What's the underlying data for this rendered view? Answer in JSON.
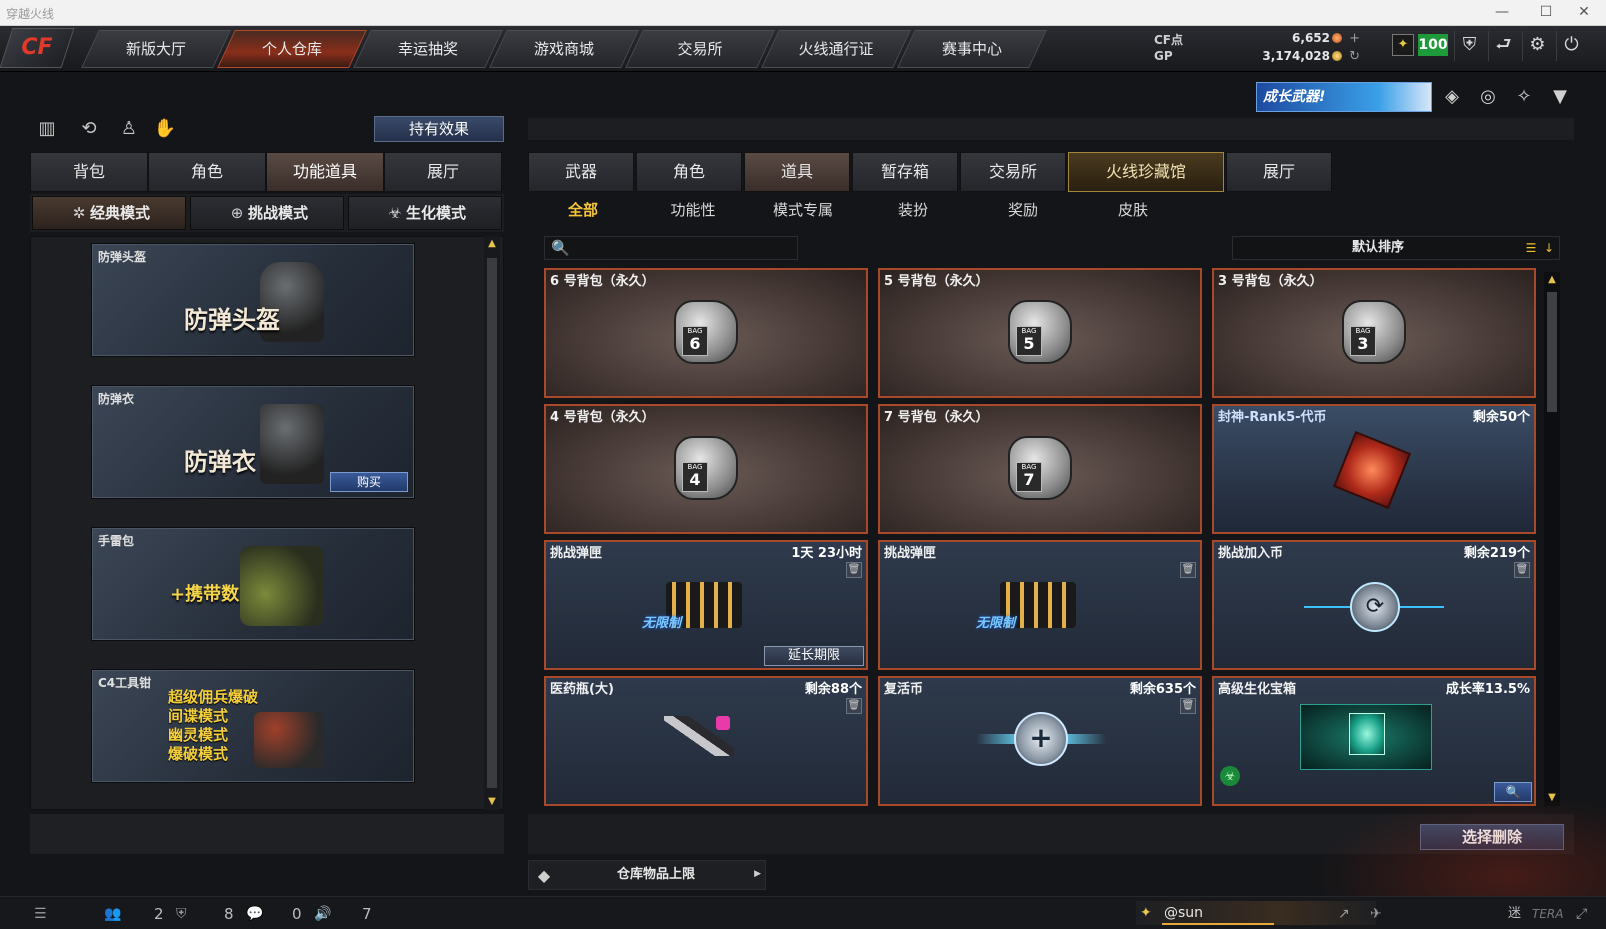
{
  "window": {
    "title": "穿越火线"
  },
  "nav": {
    "logo": "CF",
    "tabs": [
      "新版大厅",
      "个人仓库",
      "幸运抽奖",
      "游戏商城",
      "交易所",
      "火线通行证",
      "赛事中心"
    ],
    "active_tab": "个人仓库"
  },
  "currency": {
    "cf_label": "CF点",
    "cf_value": "6,652",
    "gp_label": "GP",
    "gp_value": "3,174,028"
  },
  "player": {
    "level": "100",
    "name": "@sun"
  },
  "banner": {
    "label": "成长武器!"
  },
  "left": {
    "hold_effect_label": "持有效果",
    "tabs": [
      "背包",
      "角色",
      "功能道具",
      "展厅"
    ],
    "active_tab": "功能道具",
    "modes": [
      "经典模式",
      "挑战模式",
      "生化模式"
    ],
    "active_mode": "经典模式",
    "items": [
      {
        "caption": "防弹头盔",
        "big_text": "防弹头盔"
      },
      {
        "caption": "防弹衣",
        "big_text": "防弹衣",
        "button": "购买"
      },
      {
        "caption": "手雷包",
        "big_text": "+携带数"
      },
      {
        "caption": "C4工具钳",
        "lines": [
          "超级佣兵爆破",
          "间谍模式",
          "幽灵模式",
          "爆破模式"
        ]
      }
    ]
  },
  "right": {
    "tabs": [
      "武器",
      "角色",
      "道具",
      "暂存箱",
      "交易所",
      "火线珍藏馆",
      "展厅"
    ],
    "active_tab": "道具",
    "special_tab": "火线珍藏馆",
    "subtabs": [
      "全部",
      "功能性",
      "模式专属",
      "装扮",
      "奖励",
      "皮肤"
    ],
    "active_subtab": "全部",
    "search": {
      "placeholder": "",
      "value": ""
    },
    "sort_label": "默认排序",
    "items": [
      {
        "name": "6 号背包（永久）",
        "note": "",
        "bag_no": "6",
        "bag_tag": "BAG"
      },
      {
        "name": "5 号背包（永久）",
        "note": "",
        "bag_no": "5",
        "bag_tag": "BAG"
      },
      {
        "name": "3 号背包（永久）",
        "note": "",
        "bag_no": "3",
        "bag_tag": "BAG"
      },
      {
        "name": "4 号背包（永久）",
        "note": "",
        "bag_no": "4",
        "bag_tag": "BAG"
      },
      {
        "name": "7 号背包（永久）",
        "note": "",
        "bag_no": "7",
        "bag_tag": "BAG"
      },
      {
        "name": "封神-Rank5-代币",
        "note": "剩余50个"
      },
      {
        "name": "挑战弹匣",
        "note": "1天 23小时",
        "tag": "无限制",
        "button": "延长期限"
      },
      {
        "name": "挑战弹匣",
        "note": "",
        "tag": "无限制"
      },
      {
        "name": "挑战加入币",
        "note": "剩余219个"
      },
      {
        "name": "医药瓶(大)",
        "note": "剩余88个"
      },
      {
        "name": "复活币",
        "note": "剩余635个"
      },
      {
        "name": "高级生化宝箱",
        "note": "成长率13.5%"
      }
    ],
    "delete_label": "选择删除",
    "capacity_label": "仓库物品上限"
  },
  "status": {
    "count1": "2",
    "count2": "8",
    "count3": "0",
    "count4": "7",
    "right_text": "迷",
    "brand_text": "TERA"
  },
  "colors": {
    "accent_gold": "#f5c63a",
    "card_border": "#a84a2a",
    "level_green": "#1f9a3a"
  }
}
